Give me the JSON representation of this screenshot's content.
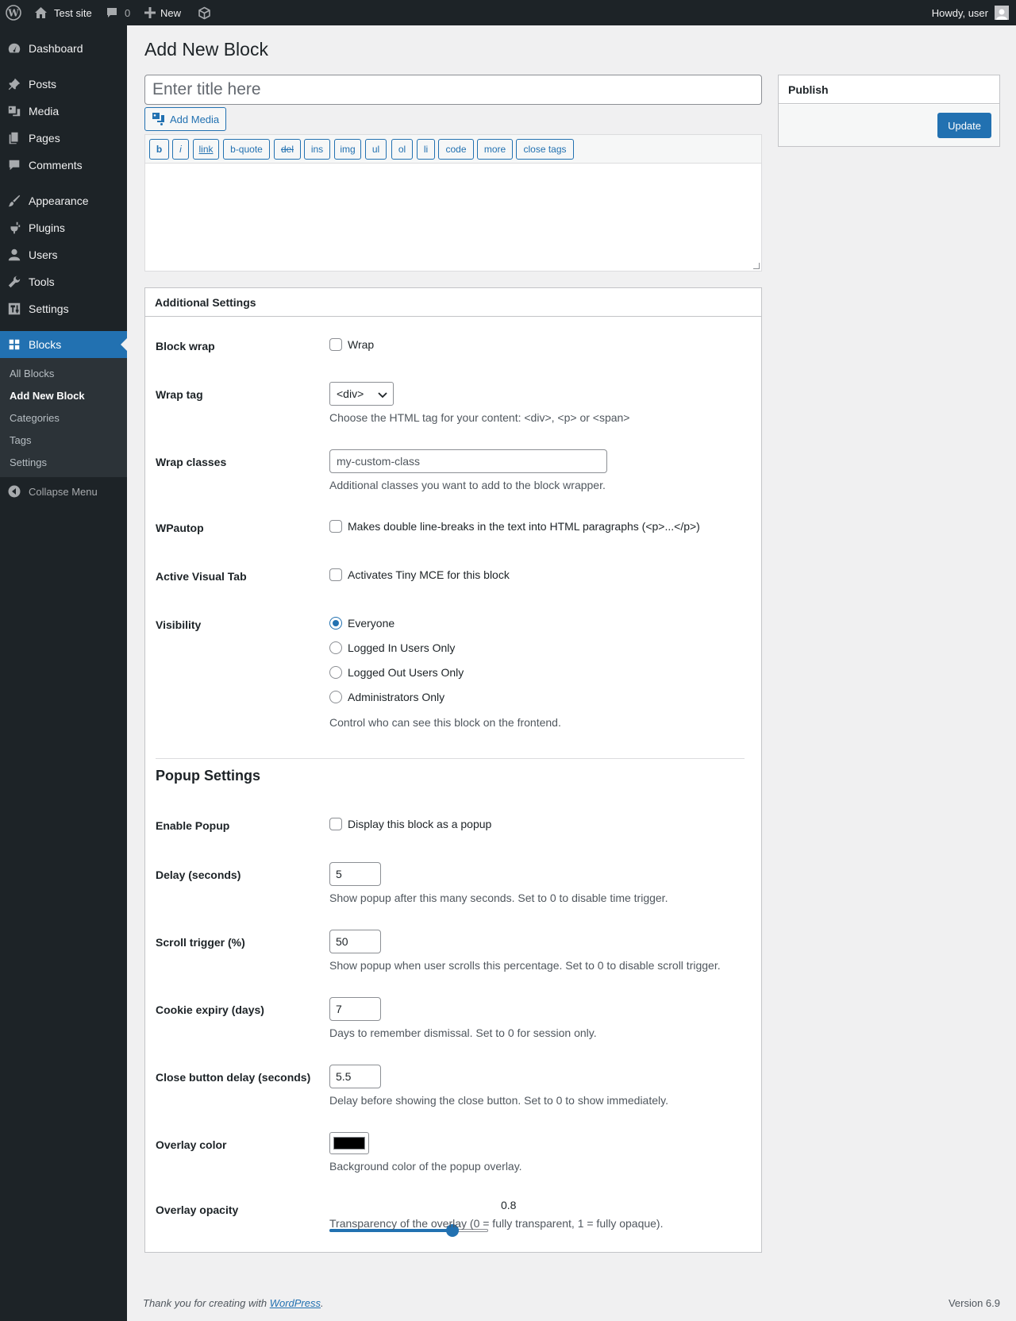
{
  "adminbar": {
    "site_name": "Test site",
    "comments_count": "0",
    "new_label": "New",
    "howdy": "Howdy, user"
  },
  "sidebar": {
    "items": [
      {
        "label": "Dashboard",
        "icon": "dashboard-icon"
      },
      {
        "label": "Posts",
        "icon": "pin-icon"
      },
      {
        "label": "Media",
        "icon": "media-icon"
      },
      {
        "label": "Pages",
        "icon": "pages-icon"
      },
      {
        "label": "Comments",
        "icon": "comment-icon"
      },
      {
        "label": "Appearance",
        "icon": "brush-icon"
      },
      {
        "label": "Plugins",
        "icon": "plug-icon"
      },
      {
        "label": "Users",
        "icon": "user-icon"
      },
      {
        "label": "Tools",
        "icon": "wrench-icon"
      },
      {
        "label": "Settings",
        "icon": "settings-icon"
      },
      {
        "label": "Blocks",
        "icon": "blocks-icon"
      }
    ],
    "submenu": [
      "All Blocks",
      "Add New Block",
      "Categories",
      "Tags",
      "Settings"
    ],
    "collapse_label": "Collapse Menu"
  },
  "page": {
    "title": "Add New Block",
    "title_placeholder": "Enter title here",
    "add_media": "Add Media"
  },
  "toolbar": {
    "buttons": [
      "b",
      "i",
      "link",
      "b-quote",
      "del",
      "ins",
      "img",
      "ul",
      "ol",
      "li",
      "code",
      "more",
      "close tags"
    ]
  },
  "publish": {
    "title": "Publish",
    "update_label": "Update"
  },
  "settings": {
    "title": "Additional Settings",
    "block_wrap": {
      "label": "Block wrap",
      "option": "Wrap"
    },
    "wrap_tag": {
      "label": "Wrap tag",
      "value": "<div>",
      "desc": "Choose the HTML tag for your content: <div>, <p> or <span>"
    },
    "wrap_classes": {
      "label": "Wrap classes",
      "placeholder": "my-custom-class",
      "desc": "Additional classes you want to add to the block wrapper."
    },
    "wpautop": {
      "label": "WPautop",
      "option": "Makes double line-breaks in the text into HTML paragraphs (<p>...</p>)"
    },
    "visual_tab": {
      "label": "Active Visual Tab",
      "option": "Activates Tiny MCE for this block"
    },
    "visibility": {
      "label": "Visibility",
      "options": [
        "Everyone",
        "Logged In Users Only",
        "Logged Out Users Only",
        "Administrators Only"
      ],
      "selected": "Everyone",
      "desc": "Control who can see this block on the frontend."
    }
  },
  "popup": {
    "title": "Popup Settings",
    "enable": {
      "label": "Enable Popup",
      "option": "Display this block as a popup"
    },
    "delay": {
      "label": "Delay (seconds)",
      "value": "5",
      "desc": "Show popup after this many seconds. Set to 0 to disable time trigger."
    },
    "scroll": {
      "label": "Scroll trigger (%)",
      "value": "50",
      "desc": "Show popup when user scrolls this percentage. Set to 0 to disable scroll trigger."
    },
    "cookie": {
      "label": "Cookie expiry (days)",
      "value": "7",
      "desc": "Days to remember dismissal. Set to 0 for session only."
    },
    "close_delay": {
      "label": "Close button delay (seconds)",
      "value": "5.5",
      "desc": "Delay before showing the close button. Set to 0 to show immediately."
    },
    "overlay_color": {
      "label": "Overlay color",
      "value": "#000000",
      "desc": "Background color of the popup overlay."
    },
    "overlay_opacity": {
      "label": "Overlay opacity",
      "value": "0.8",
      "desc": "Transparency of the overlay (0 = fully transparent, 1 = fully opaque)."
    }
  },
  "footer": {
    "thanks_prefix": "Thank you for creating with ",
    "thanks_link": "WordPress",
    "thanks_suffix": ".",
    "version": "Version 6.9"
  },
  "colors": {
    "accent": "#2271b1",
    "adminbar_bg": "#1d2327",
    "submenu_bg": "#2c3338"
  }
}
